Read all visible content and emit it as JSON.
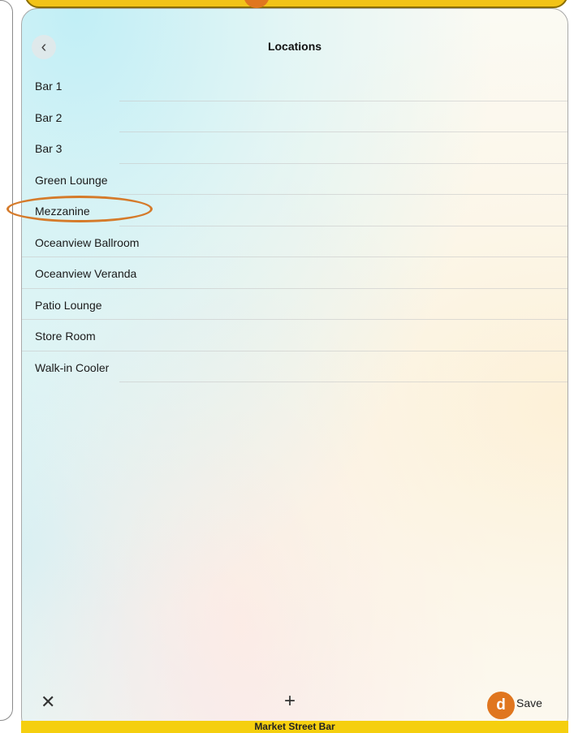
{
  "header": {
    "title": "Locations",
    "back_icon": "chevron-left-icon"
  },
  "locations": [
    "Bar 1",
    "Bar 2",
    "Bar 3",
    "Green Lounge",
    "Mezzanine",
    "Oceanview Ballroom",
    "Oceanview Veranda",
    "Patio Lounge",
    "Store Room",
    "Walk-in Cooler"
  ],
  "highlighted_location": "Mezzanine",
  "toolbar": {
    "close_icon": "close-icon",
    "add_icon": "plus-icon",
    "callout_label": "d",
    "save_label": "Save"
  },
  "footer": {
    "venue_name": "Market Street Bar"
  },
  "colors": {
    "accent_yellow": "#f5cf0f",
    "callout_orange": "#e0761f"
  }
}
